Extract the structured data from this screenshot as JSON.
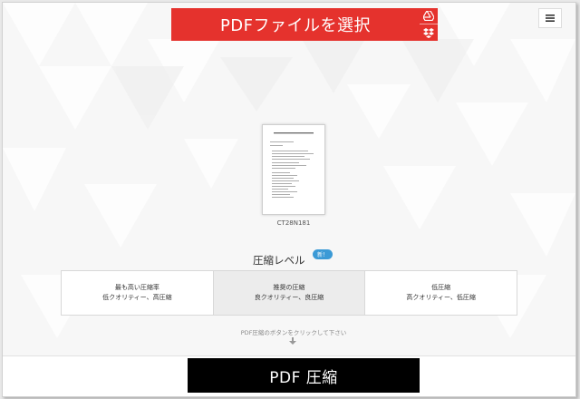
{
  "header": {
    "select_button_label": "PDFファイルを選択",
    "cloud_buttons": [
      {
        "icon": "google-drive-icon"
      },
      {
        "icon": "dropbox-icon"
      }
    ],
    "menu_icon": "hamburger-menu-icon"
  },
  "file": {
    "name": "CT28N181"
  },
  "compression": {
    "title": "圧縮レベル",
    "badge": "新！",
    "options": [
      {
        "title": "最も高い圧縮率",
        "desc": "低クオリティー、高圧縮",
        "selected": false
      },
      {
        "title": "推奨の圧縮",
        "desc": "良クオリティー、良圧縮",
        "selected": true
      },
      {
        "title": "低圧縮",
        "desc": "高クオリティー、低圧縮",
        "selected": false
      }
    ],
    "hint": "PDF圧縮のボタンをクリックして下さい"
  },
  "footer": {
    "compress_button_label": "PDF 圧縮"
  },
  "colors": {
    "accent_red": "#e5322d",
    "badge_blue": "#3b9ad6",
    "primary_button": "#000000"
  }
}
